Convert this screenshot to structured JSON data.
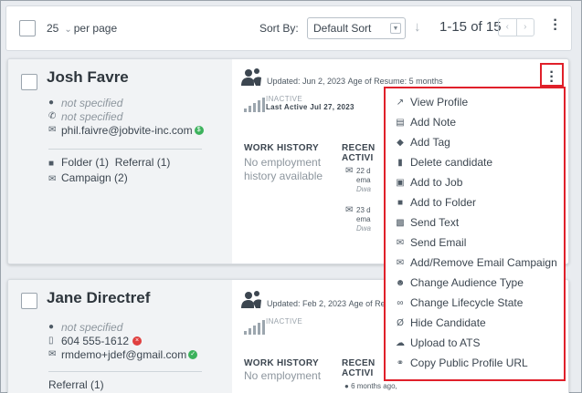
{
  "toolbar": {
    "per_page_value": "25",
    "per_page_label": "per page",
    "sort_by_label": "Sort By:",
    "sort_selected": "Default Sort",
    "range_text": "1-15 of 15"
  },
  "candidates": [
    {
      "name": "Josh Favre",
      "location": "not specified",
      "phone": "not specified",
      "email": "phil.faivre@jobvite-inc.com",
      "folder": "Folder (1)",
      "referral": "Referral (1)",
      "campaign": "Campaign (2)",
      "updated": "Updated: Jun 2, 2023",
      "age_of_resume": "Age of Resume: 5 months",
      "status": "INACTIVE",
      "last_active": "Last Active Jul 27, 2023",
      "work_history_heading": "WORK HISTORY",
      "work_history_empty": "No employment history available",
      "recent_heading_1": "RECEN",
      "recent_heading_2": "ACTIVI",
      "recent_1_line1": "22 d",
      "recent_1_line2": "ema",
      "recent_1_line3": "Dwa",
      "recent_2_line1": "23 d",
      "recent_2_line2": "ema",
      "recent_2_line3": "Dwa"
    },
    {
      "name": "Jane Directref",
      "location": "not specified",
      "phone": "604 555-1612",
      "email": "rmdemo+jdef@gmail.com",
      "referral": "Referral (1)",
      "updated": "Updated: Feb 2, 2023",
      "age_of_resume": "Age of Re",
      "status": "INACTIVE",
      "work_history_heading": "WORK HISTORY",
      "work_history_empty": "No employment",
      "recent_heading_1": "RECEN",
      "recent_heading_2": "ACTIVI",
      "recent_1_line1": "6 months ago,"
    }
  ],
  "menu": {
    "items": [
      {
        "label": "View Profile",
        "icon": "external-link-icon"
      },
      {
        "label": "Add Note",
        "icon": "note-icon"
      },
      {
        "label": "Add Tag",
        "icon": "tag-icon"
      },
      {
        "label": "Delete candidate",
        "icon": "trash-icon"
      },
      {
        "label": "Add to Job",
        "icon": "briefcase-icon"
      },
      {
        "label": "Add to Folder",
        "icon": "folder-icon"
      },
      {
        "label": "Send Text",
        "icon": "sms-icon"
      },
      {
        "label": "Send Email",
        "icon": "envelope-icon"
      },
      {
        "label": "Add/Remove Email Campaign",
        "icon": "campaign-icon"
      },
      {
        "label": "Change Audience Type",
        "icon": "audience-icon"
      },
      {
        "label": "Change Lifecycle State",
        "icon": "infinity-icon"
      },
      {
        "label": "Hide Candidate",
        "icon": "eye-slash-icon"
      },
      {
        "label": "Upload to ATS",
        "icon": "cloud-upload-icon"
      },
      {
        "label": "Copy Public Profile URL",
        "icon": "link-icon"
      }
    ]
  },
  "colors": {
    "highlight": "#e0202a",
    "verified": "#3cb25c",
    "error": "#e0403f"
  }
}
